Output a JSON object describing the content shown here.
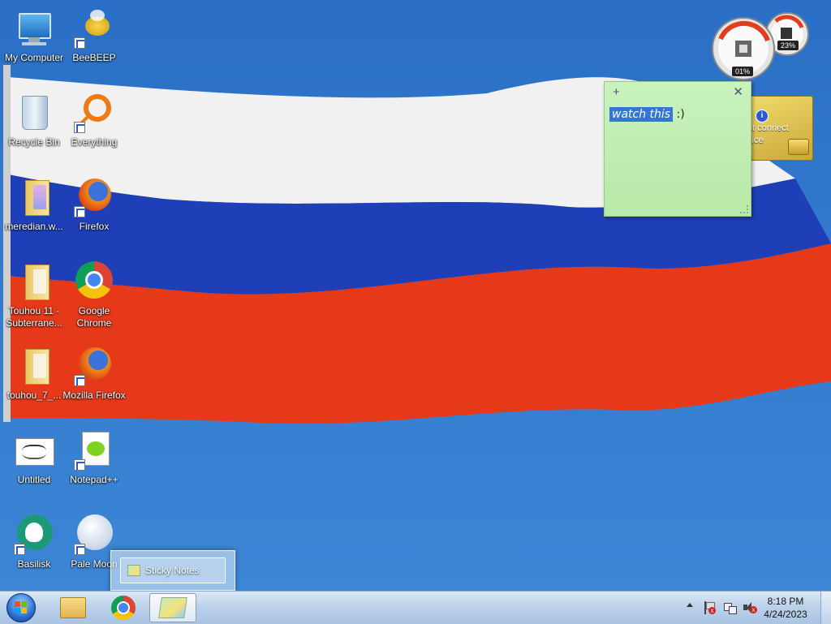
{
  "desktop_icons": [
    {
      "label": "My Computer"
    },
    {
      "label": "BeeBEEP"
    },
    {
      "label": "Recycle Bin"
    },
    {
      "label": "Everything"
    },
    {
      "label": "meredian.w..."
    },
    {
      "label": "Firefox"
    },
    {
      "label": "Touhou 11 - Subterrane..."
    },
    {
      "label": "Google Chrome"
    },
    {
      "label": "touhou_7_..."
    },
    {
      "label": "Mozilla Firefox"
    },
    {
      "label": "Untitled"
    },
    {
      "label": "Notepad++"
    },
    {
      "label": "Basilisk"
    },
    {
      "label": "Pale Moon"
    }
  ],
  "gadgets": {
    "cpu_meter": {
      "cpu": "01%",
      "memory": "23%"
    },
    "sticky_note": {
      "selected_text": "watch this",
      "rest_text": " :)"
    },
    "card_gadget": {
      "text_line1": "ot connect",
      "text_line2": "vice",
      "info_icon": "info-icon"
    }
  },
  "thumbnail": {
    "label": "Sticky Notes"
  },
  "taskbar": {
    "start": "start-orb",
    "pinned": [
      "explorer-icon",
      "chrome-icon",
      "sticky-notes-icon"
    ]
  },
  "clock": {
    "time": "8:18 PM",
    "date": "4/24/2023"
  }
}
